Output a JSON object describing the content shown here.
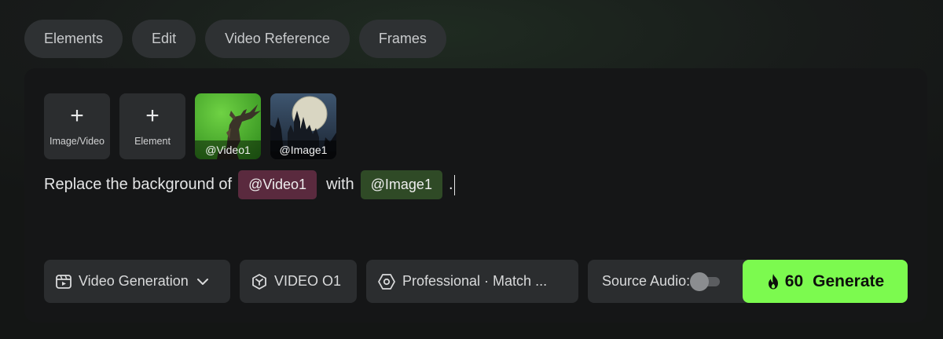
{
  "tabs": [
    {
      "label": "Elements"
    },
    {
      "label": "Edit"
    },
    {
      "label": "Video Reference"
    },
    {
      "label": "Frames"
    }
  ],
  "uploads": {
    "add_media_label": "Image/Video",
    "add_element_label": "Element",
    "items": [
      {
        "tag": "@Video1"
      },
      {
        "tag": "@Image1"
      }
    ]
  },
  "prompt": {
    "text_before": "Replace the background of",
    "ref1": "@Video1",
    "text_middle": "with",
    "ref2": "@Image1",
    "text_after": "."
  },
  "toolbar": {
    "mode": "Video Generation",
    "model": "VIDEO O1",
    "quality": "Professional · Match ...",
    "source_audio_label": "Source Audio:",
    "source_audio_on": false
  },
  "generate": {
    "credits": "60",
    "label": "Generate"
  },
  "colors": {
    "accent": "#7cfa4f",
    "video_chip": "#5a2a3e",
    "image_chip": "#2f4a26"
  }
}
